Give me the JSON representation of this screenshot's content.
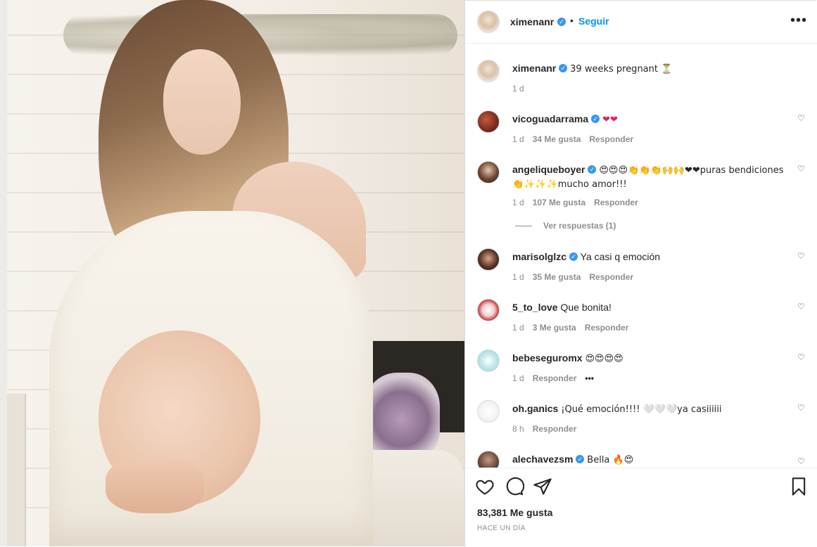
{
  "post_owner": {
    "username": "ximenanr",
    "follow_label": "Seguir",
    "separator": "•",
    "more_icon": "ellipsis-icon"
  },
  "caption": {
    "username": "ximenanr",
    "text": "39 weeks pregnant ⏳",
    "time": "1 d"
  },
  "comments": [
    {
      "username": "vicoguadarrama",
      "verified": true,
      "text": "❤❤",
      "time": "1 d",
      "likes": "34 Me gusta",
      "reply": "Responder"
    },
    {
      "username": "angeliqueboyer",
      "verified": true,
      "text": "😍😍😍👏👏👏🙌🙌❤❤puras bendiciones 👏✨✨✨mucho amor!!!",
      "time": "1 d",
      "likes": "107 Me gusta",
      "reply": "Responder",
      "view_replies": "Ver respuestas (1)"
    },
    {
      "username": "marisolglzc",
      "verified": true,
      "text": "Ya casi q emoción",
      "time": "1 d",
      "likes": "35 Me gusta",
      "reply": "Responder"
    },
    {
      "username": "5_to_love",
      "verified": false,
      "text": "Que bonita!",
      "time": "1 d",
      "likes": "3 Me gusta",
      "reply": "Responder"
    },
    {
      "username": "bebeseguromx",
      "verified": false,
      "text": "😍😍😍😍",
      "time": "1 d",
      "likes": "",
      "reply": "Responder",
      "more": "•••"
    },
    {
      "username": "oh.ganics",
      "verified": false,
      "text": "¡Qué emoción!!!! 🤍🤍🤍ya casiiiiii",
      "time": "8 h",
      "likes": "",
      "reply": "Responder"
    },
    {
      "username": "alechavezsm",
      "verified": true,
      "text": "Bella 🔥😍",
      "time": "",
      "likes": "",
      "reply": ""
    }
  ],
  "footer": {
    "likes": "83,381 Me gusta",
    "date": "HACE UN DÍA"
  },
  "icons": {
    "verified": "✓",
    "heart_small": "♡"
  },
  "colors": {
    "link": "#0095f6",
    "verified": "#3897f0",
    "muted": "#8e8e8e"
  }
}
